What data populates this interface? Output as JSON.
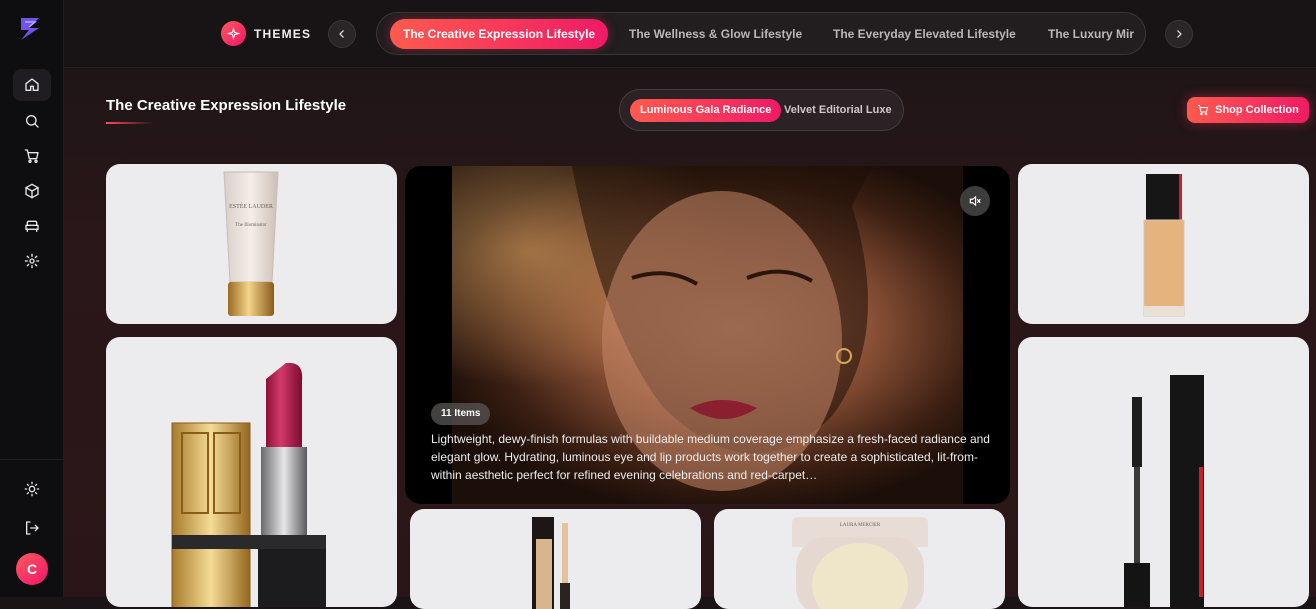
{
  "header": {
    "themes_label": "THEMES",
    "tabs": [
      {
        "label": "The Creative Expression Lifestyle"
      },
      {
        "label": "The Wellness & Glow Lifestyle"
      },
      {
        "label": "The Everyday Elevated Lifestyle"
      },
      {
        "label": "The Luxury Mir"
      }
    ]
  },
  "sidebar": {
    "avatar_initial": "C"
  },
  "section": {
    "title": "The Creative Expression Lifestyle",
    "subtabs": [
      {
        "label": "Luminous Gala Radiance"
      },
      {
        "label": "Velvet Editorial Luxe"
      }
    ],
    "shop_label": "Shop Collection"
  },
  "hero": {
    "items_badge": "11 Items",
    "description": "Lightweight, dewy-finish formulas with buildable medium coverage emphasize a fresh-faced radiance and elegant glow. Hydrating, luminous eye and lip products work together to create a sophisticated, lit-from-within aesthetic perfect for refined evening celebrations and red-carpet…"
  },
  "products": {
    "primer_brand": "ESTÉE LAUDER",
    "primer_name": "The Illuminator",
    "compact_brand": "LAURA MERCIER"
  },
  "colors": {
    "accent": "#ff5a4e",
    "accent_end": "#ef1a66",
    "logo": "#7c5cff"
  },
  "icons": {
    "logo": "brand-logo-icon",
    "nav": [
      "home-icon",
      "search-icon",
      "cart-icon",
      "box-icon",
      "sofa-icon",
      "settings-icon"
    ],
    "bottom": [
      "sun-icon",
      "logout-icon"
    ],
    "themes": "sparkle-icon",
    "mute": "volume-mute-icon"
  }
}
